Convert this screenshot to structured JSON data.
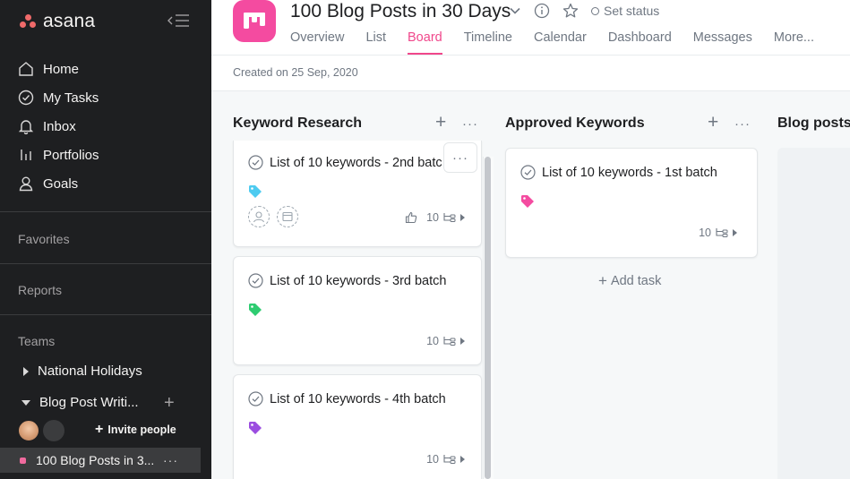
{
  "sidebar": {
    "logo_text": "asana",
    "nav": [
      {
        "label": "Home",
        "icon": "home-icon"
      },
      {
        "label": "My Tasks",
        "icon": "check-circle-icon"
      },
      {
        "label": "Inbox",
        "icon": "bell-icon"
      },
      {
        "label": "Portfolios",
        "icon": "bar-chart-icon"
      },
      {
        "label": "Goals",
        "icon": "person-icon"
      }
    ],
    "favorites_label": "Favorites",
    "reports_label": "Reports",
    "teams_label": "Teams",
    "teams": [
      {
        "label": "National Holidays",
        "expanded": false
      },
      {
        "label": "Blog Post Writi...",
        "expanded": true
      }
    ],
    "invite_label": "Invite people",
    "current_project": "100 Blog Posts in 3...",
    "project_color": "#f06a9e"
  },
  "header": {
    "title": "100 Blog Posts in 30 Days",
    "set_status": "Set status",
    "project_color": "#f44ba0",
    "tabs": [
      "Overview",
      "List",
      "Board",
      "Timeline",
      "Calendar",
      "Dashboard",
      "Messages",
      "More..."
    ],
    "active_tab": "Board",
    "accent": "#f0478b"
  },
  "subbar": {
    "created": "Created on 25 Sep, 2020"
  },
  "board": {
    "columns": [
      {
        "title": "Keyword Research",
        "cards": [
          {
            "title": "List of 10 keywords - 2nd batc",
            "tag_color": "#4ecbf0",
            "subtasks": "10",
            "hovered": true
          },
          {
            "title": "List of 10 keywords - 3rd batch",
            "tag_color": "#2ecc71",
            "subtasks": "10"
          },
          {
            "title": "List of 10 keywords - 4th batch",
            "tag_color": "#9b4de0",
            "subtasks": "10"
          }
        ]
      },
      {
        "title": "Approved Keywords",
        "cards": [
          {
            "title": "List of 10 keywords - 1st batch",
            "tag_color": "#f44ba0",
            "subtasks": "10"
          }
        ],
        "add_task": "Add task"
      },
      {
        "title": "Blog posts",
        "cards": []
      }
    ]
  }
}
